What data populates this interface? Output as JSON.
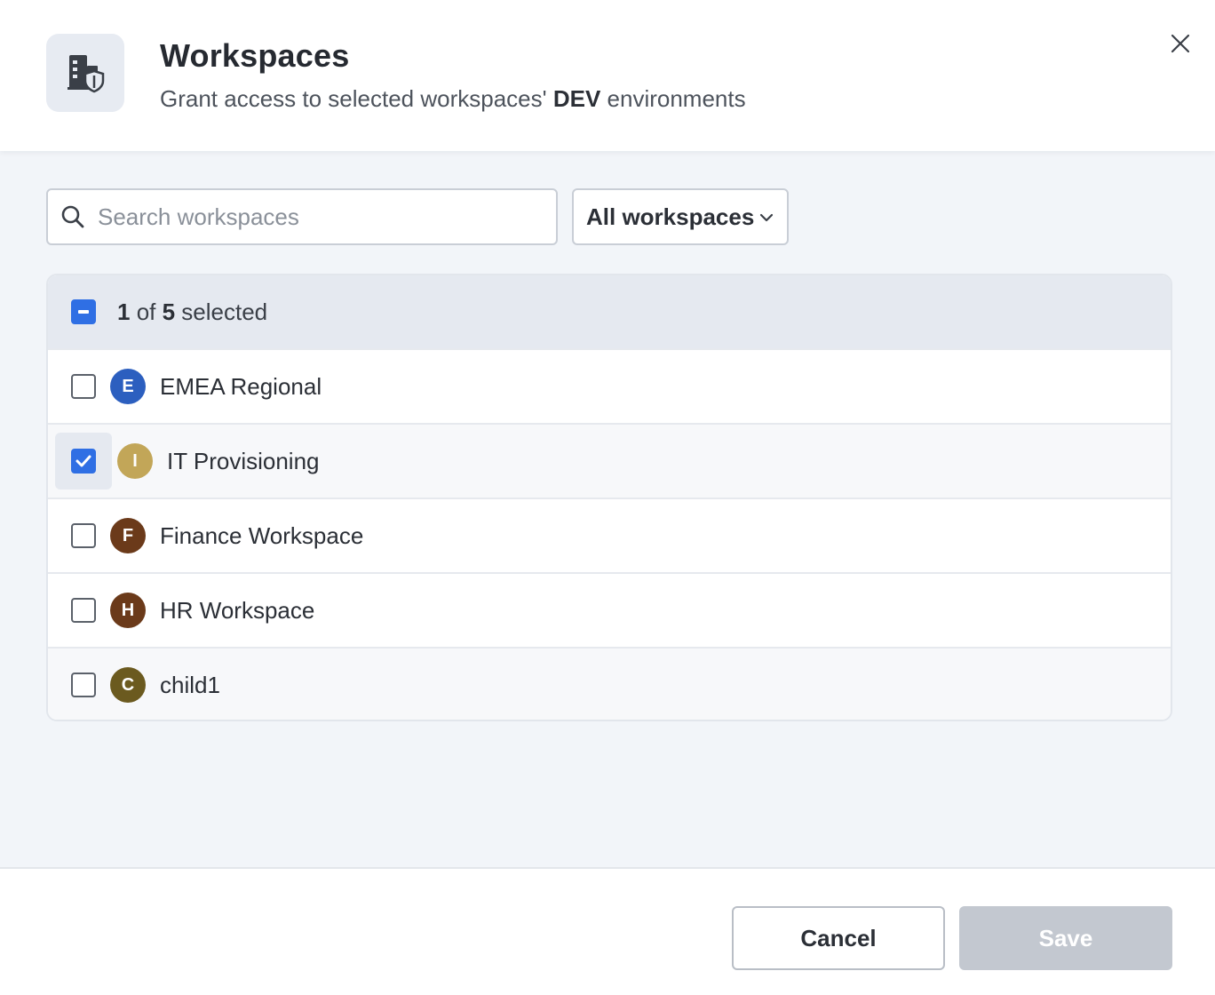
{
  "header": {
    "icon": "building-shield-icon",
    "title": "Workspaces",
    "subtitle_prefix": "Grant access to selected workspaces' ",
    "subtitle_env": "DEV",
    "subtitle_suffix": " environments",
    "close_icon": "close-icon"
  },
  "search": {
    "placeholder": "Search workspaces",
    "value": ""
  },
  "filter": {
    "selected": "All workspaces"
  },
  "list": {
    "selection": {
      "selected": "1",
      "of": " of ",
      "total": "5",
      "suffix": " selected",
      "state": "indeterminate"
    },
    "items": [
      {
        "initial": "E",
        "name": "EMEA Regional",
        "color": "#2c5fbf",
        "checked": false
      },
      {
        "initial": "I",
        "name": "IT Provisioning",
        "color": "#c2a658",
        "checked": true
      },
      {
        "initial": "F",
        "name": "Finance Workspace",
        "color": "#6b3a1a",
        "checked": false
      },
      {
        "initial": "H",
        "name": "HR Workspace",
        "color": "#6b3a1a",
        "checked": false
      },
      {
        "initial": "C",
        "name": "child1",
        "color": "#6b5a1f",
        "checked": false
      }
    ]
  },
  "footer": {
    "cancel_label": "Cancel",
    "save_label": "Save"
  },
  "colors": {
    "accent": "#2f6fe4",
    "save_disabled": "#c3c8d0"
  }
}
